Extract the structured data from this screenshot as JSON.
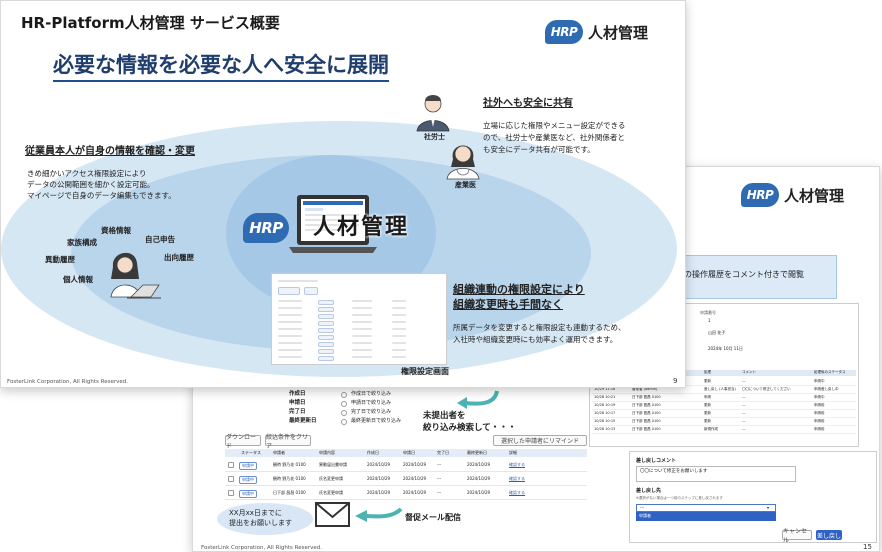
{
  "colors": {
    "accent": "#2e6bb3",
    "title_underline": "#1f4e8c",
    "arrow": "#4bb3b0",
    "ellipse_outer": "#d6e7f4",
    "ellipse_mid": "#b9d5ec",
    "ellipse_inner": "#a5c8e7"
  },
  "front": {
    "title": "HR-Platform人材管理 サービス概要",
    "logo_badge": "HRP",
    "logo_text": "人材管理",
    "headline": "必要な情報を必要な人へ安全に展開",
    "employee": {
      "heading": "従業員本人が自身の情報を確認・変更",
      "body": [
        "きめ細かいアクセス権限設定により",
        "データの公開範囲を細かく設定可能。",
        "マイページで自身のデータ編集もできます。"
      ],
      "tags": [
        "資格情報",
        "家族構成",
        "自己申告",
        "異動履歴",
        "出向履歴",
        "個人情報"
      ]
    },
    "external": {
      "heading": "社外へも安全に共有",
      "body": [
        "立場に応じた権限やメニュー設定ができる",
        "ので、社労士や産業医など、社外関係者と",
        "も安全にデータ共有が可能です。"
      ],
      "roles": [
        "社労士",
        "産業医"
      ]
    },
    "center_logo_badge": "HRP",
    "center_logo_text": "人材管理",
    "org": {
      "heading_lines": [
        "組織連動の権限設定により",
        "組織変更時も手間なく"
      ],
      "body": [
        "所属データを変更すると権限設定も連動するため、",
        "入社時や組織変更時にも効率よく運用できます。"
      ],
      "caption": "権限設定画面"
    },
    "footer": "FosterLink Corporation, All Rights Reserved.",
    "page": "9"
  },
  "back": {
    "logo_badge": "HRP",
    "logo_text": "人材管理",
    "banner": "の操作履歴をコメント付きで閲覧",
    "filters": [
      "作成日",
      "申請日",
      "完了日",
      "最終更新日"
    ],
    "filter_options": [
      "作成日で絞り込み",
      "申請日で絞り込み",
      "完了日で絞り込み",
      "最終更新日で絞り込み"
    ],
    "callout_filter": [
      "未提出者を",
      "絞り込み検索して・・・"
    ],
    "buttons": {
      "download": "ダウンロード",
      "clear": "絞込条件をクリア",
      "remind": "選択した申請者にリマインド"
    },
    "table_headers": [
      "ステータス",
      "申請者",
      "申請内容",
      "作成日",
      "申請日",
      "完了日",
      "最終更新日",
      "詳細"
    ],
    "table_rows": [
      {
        "status": "申請中",
        "name": "観時 野乃花 0100",
        "content": "異動届出書申請",
        "created": "2024/10/29",
        "applied": "2024/10/29",
        "done": "---",
        "updated": "2024/10/29",
        "link": "確認する"
      },
      {
        "status": "申請中",
        "name": "観時 野乃花 0100",
        "content": "氏名変更申請",
        "created": "2024/10/29",
        "applied": "2024/10/29",
        "done": "---",
        "updated": "2024/10/29",
        "link": "確認する"
      },
      {
        "status": "申請中",
        "name": "日下部 昌昌 0100",
        "content": "氏名変更申請",
        "created": "2024/10/29",
        "applied": "2024/10/29",
        "done": "---",
        "updated": "2024/10/29",
        "link": "確認する"
      }
    ],
    "bubble": [
      "XX月xx日までに",
      "提出をお願いします"
    ],
    "mail_caption": "督促メール配信",
    "detail": {
      "labels": [
        "申請番号",
        "ステータス",
        "申請日"
      ],
      "values": [
        "1",
        "山田 花子",
        "2024年 10月 11日"
      ],
      "log_headers": [
        "日時",
        "処理者",
        "処理",
        "コメント",
        "処理後のステータス"
      ],
      "log_rows": [
        [
          "10/29 11:17",
          "日下部 昌昌 0100",
          "更新",
          "---",
          "申請中"
        ],
        [
          "10/29 11:16",
          "管理者 (admin)",
          "差し戻し (人事担当)",
          "〇〇について修正してください",
          "申請差し戻し中"
        ],
        [
          "10/28 10:21",
          "日下部 昌昌 0100",
          "申請",
          "---",
          "申請中"
        ],
        [
          "10/28 10:19",
          "日下部 昌昌 0100",
          "更新",
          "---",
          "申請前"
        ],
        [
          "10/28 10:17",
          "日下部 昌昌 0100",
          "更新",
          "---",
          "申請前"
        ],
        [
          "10/28 10:15",
          "日下部 昌昌 0100",
          "更新",
          "---",
          "申請前"
        ],
        [
          "10/28 10:13",
          "日下部 昌昌 0100",
          "新規作成",
          "---",
          "申請前"
        ]
      ]
    },
    "comment_panel": {
      "label": "差し戻しコメント",
      "text": "〇〇について修正をお願いします",
      "return_label": "差し戻し先",
      "return_hint": "※選択がない場合は一つ前のステップに差し戻されます",
      "options": [
        "---",
        "申請者"
      ],
      "cancel": "キャンセル",
      "submit": "差し戻し"
    },
    "footer": "FosterLink Corporation, All Rights Reserved.",
    "page": "15"
  }
}
